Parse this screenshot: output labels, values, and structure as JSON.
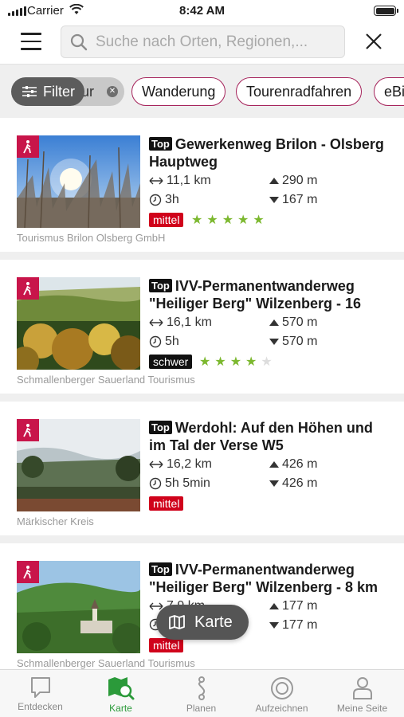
{
  "status_bar": {
    "carrier": "Carrier",
    "time": "8:42 AM"
  },
  "search": {
    "placeholder": "Suche nach Orten, Regionen,..."
  },
  "filters": {
    "filter_label": "Filter",
    "partial_chip_label": "ur",
    "chips": [
      "Wanderung",
      "Tourenradfahren",
      "eBike"
    ]
  },
  "tours": [
    {
      "top_label": "Top",
      "title": "Gewerkenweg Brilon - Olsberg Hauptweg",
      "distance": "11,1 km",
      "duration": "3h",
      "ascent": "290 m",
      "descent": "167 m",
      "difficulty": "mittel",
      "rating": 5,
      "source": "Tourismus Brilon Olsberg GmbH",
      "category_icon": "hiking-icon"
    },
    {
      "top_label": "Top",
      "title": "IVV-Permanentwanderweg \"Heiliger Berg\" Wilzenberg - 16",
      "distance": "16,1 km",
      "duration": "5h",
      "ascent": "570 m",
      "descent": "570 m",
      "difficulty": "schwer",
      "rating": 4,
      "source": "Schmallenberger Sauerland Tourismus",
      "category_icon": "hiking-icon"
    },
    {
      "top_label": "Top",
      "title": "Werdohl: Auf den Höhen und im Tal der Verse W5",
      "distance": "16,2 km",
      "duration": "5h 5min",
      "ascent": "426 m",
      "descent": "426 m",
      "difficulty": "mittel",
      "rating": 0,
      "source": "Märkischer Kreis",
      "category_icon": "hiking-icon"
    },
    {
      "top_label": "Top",
      "title": "IVV-Permanentwanderweg \"Heiliger Berg\" Wilzenberg - 8 km",
      "distance": "7,9 km",
      "duration": "",
      "ascent": "177 m",
      "descent": "177 m",
      "difficulty": "mittel",
      "rating": 0,
      "source": "Schmallenberger Sauerland Tourismus",
      "category_icon": "hiking-icon"
    }
  ],
  "map_button": {
    "label": "Karte"
  },
  "tab_bar": [
    {
      "label": "Entdecken",
      "icon": "speech-bubble-icon",
      "active": false
    },
    {
      "label": "Karte",
      "icon": "map-search-icon",
      "active": true
    },
    {
      "label": "Planen",
      "icon": "route-icon",
      "active": false
    },
    {
      "label": "Aufzeichnen",
      "icon": "record-icon",
      "active": false
    },
    {
      "label": "Meine Seite",
      "icon": "profile-icon",
      "active": false
    }
  ],
  "colors": {
    "brand": "#c8154a",
    "chip_border": "#a5225a",
    "difficulty_medium": "#d0021b",
    "difficulty_hard": "#111111",
    "star": "#7cb82f",
    "active_tab": "#2b9a3a"
  }
}
